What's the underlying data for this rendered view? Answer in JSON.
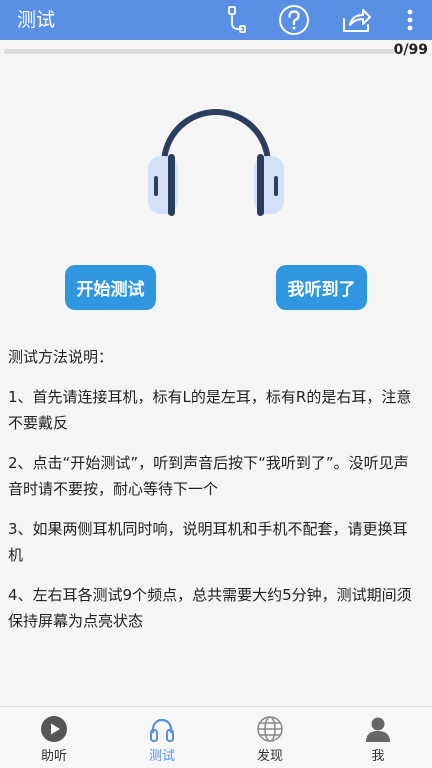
{
  "header": {
    "title": "测试",
    "icons": [
      "usb-plug-icon",
      "help-icon",
      "share-icon",
      "more-vert-icon"
    ]
  },
  "progress": {
    "label": "0/99",
    "fraction": 0
  },
  "buttons": {
    "start": "开始测试",
    "heard": "我听到了"
  },
  "instructions": {
    "heading": "测试方法说明：",
    "items": [
      "1、首先请连接耳机，标有L的是左耳，标有R的是右耳，注意不要戴反",
      "2、点击“开始测试”，听到声音后按下“我听到了”。没听见声音时请不要按，耐心等待下一个",
      "3、如果两侧耳机同时响，说明耳机和手机不配套，请更换耳机",
      "4、左右耳各测试9个频点，总共需要大约5分钟，测试期间须保持屏幕为点亮状态"
    ]
  },
  "tabs": [
    {
      "label": "助听",
      "icon": "play-circle-icon",
      "active": false
    },
    {
      "label": "测试",
      "icon": "headphones-icon",
      "active": true
    },
    {
      "label": "发现",
      "icon": "globe-icon",
      "active": false
    },
    {
      "label": "我",
      "icon": "person-icon",
      "active": false
    }
  ],
  "colors": {
    "appbar": "#5a8fe6",
    "button": "#2e97df",
    "active_tab": "#5a8fe6"
  }
}
